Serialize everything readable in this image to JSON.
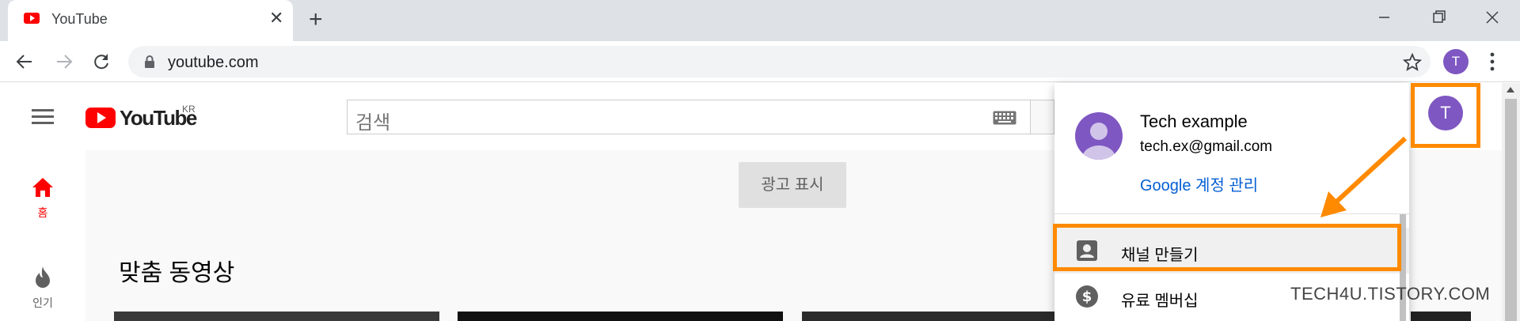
{
  "browser": {
    "tab": {
      "title": "YouTube",
      "close_glyph": "✕"
    },
    "new_tab_glyph": "+",
    "window_controls": [
      "minimize-icon",
      "restore-icon",
      "close-icon"
    ],
    "address": {
      "url": "youtube.com"
    },
    "profile_initial": "T"
  },
  "youtube": {
    "logo_text": "YouTube",
    "region": "KR",
    "search": {
      "placeholder": "검색"
    },
    "guide": [
      {
        "label": "홈",
        "icon": "home-icon",
        "active": true
      },
      {
        "label": "인기",
        "icon": "fire-icon",
        "active": false
      }
    ],
    "ad_button": "광고 표시",
    "section_title": "맞춤 동영상",
    "avatar_initial": "T"
  },
  "account_menu": {
    "name": "Tech example",
    "email": "tech.ex@gmail.com",
    "manage_link": "Google 계정 관리",
    "items": [
      {
        "label": "채널 만들기",
        "icon": "person-card-icon"
      },
      {
        "label": "유료 멤버십",
        "icon": "dollar-circle-icon"
      }
    ]
  },
  "annotation": {
    "watermark": "TECH4U.TISTORY.COM",
    "highlight_color": "#ff8a00"
  },
  "colors": {
    "youtube_red": "#ff0000",
    "avatar_purple": "#7e57c2",
    "link_blue": "#065fd4"
  }
}
